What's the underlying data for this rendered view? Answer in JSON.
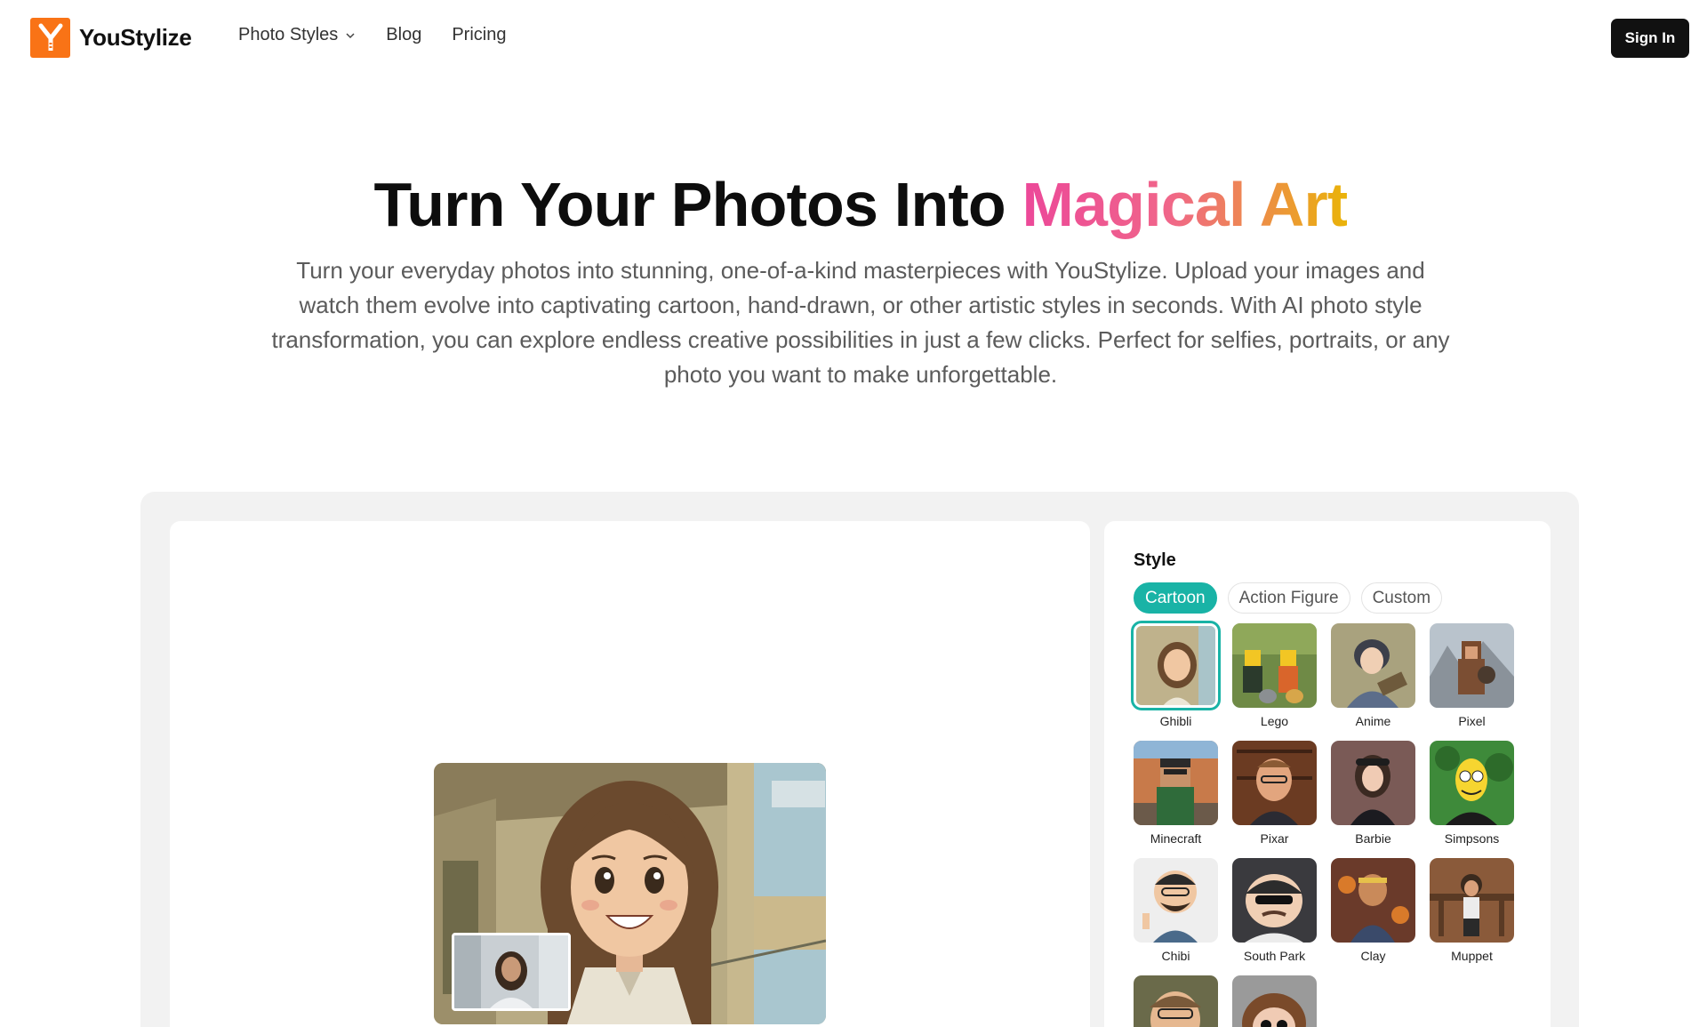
{
  "header": {
    "brand": "YouStylize",
    "nav": [
      {
        "label": "Photo Styles",
        "has_dropdown": true
      },
      {
        "label": "Blog"
      },
      {
        "label": "Pricing"
      }
    ],
    "sign_in": "Sign In"
  },
  "hero": {
    "title_plain": "Turn Your Photos Into ",
    "title_highlight": "Magical Art",
    "subtitle": "Turn your everyday photos into stunning, one-of-a-kind masterpieces with YouStylize. Upload your images and watch them evolve into captivating cartoon, hand-drawn, or other artistic styles in seconds. With AI photo style transformation, you can explore endless creative possibilities in just a few clicks. Perfect for selfies, portraits, or any photo you want to make unforgettable."
  },
  "style_panel": {
    "label": "Style",
    "tabs": [
      {
        "label": "Cartoon",
        "active": true
      },
      {
        "label": "Action Figure",
        "active": false
      },
      {
        "label": "Custom",
        "active": false
      }
    ],
    "styles": [
      {
        "name": "Ghibli",
        "selected": true
      },
      {
        "name": "Lego"
      },
      {
        "name": "Anime"
      },
      {
        "name": "Pixel"
      },
      {
        "name": "Minecraft"
      },
      {
        "name": "Pixar"
      },
      {
        "name": "Barbie"
      },
      {
        "name": "Simpsons"
      },
      {
        "name": "Chibi"
      },
      {
        "name": "South Park"
      },
      {
        "name": "Clay"
      },
      {
        "name": "Muppet"
      },
      {
        "name": ""
      },
      {
        "name": ""
      }
    ]
  },
  "colors": {
    "accent": "#19b3a6",
    "brand": "#f97316",
    "gradient_start": "#ec4899",
    "gradient_end": "#eab308"
  }
}
